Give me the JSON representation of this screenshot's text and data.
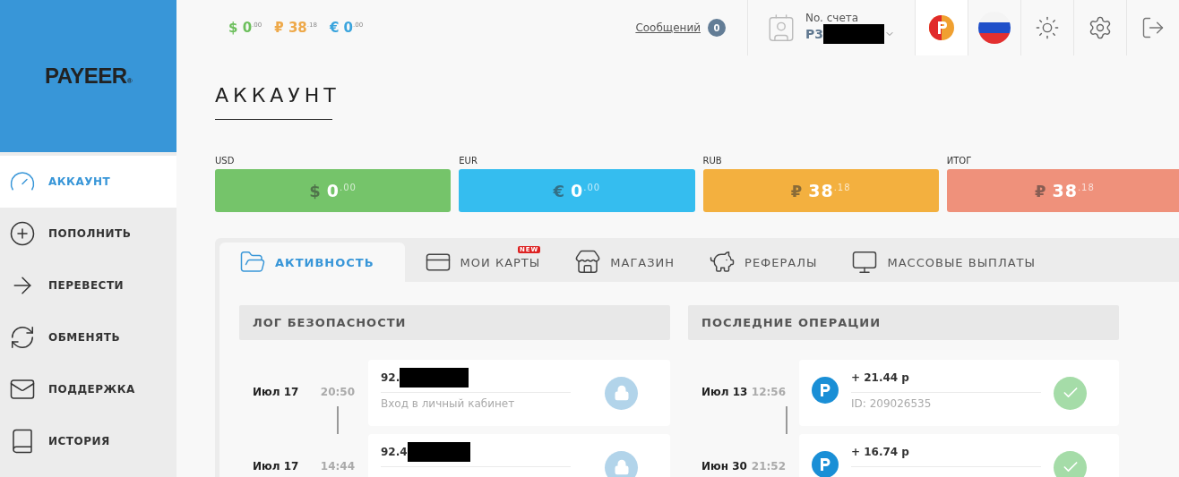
{
  "logo": {
    "text": "PAYEER",
    "mark": "®"
  },
  "sidebar": {
    "items": [
      {
        "label": "АККАУНТ",
        "kind": "gauge",
        "selected": true
      },
      {
        "label": "ПОПОЛНИТЬ",
        "kind": "plus",
        "selected": false
      },
      {
        "label": "ПЕРЕВЕСТИ",
        "kind": "arrow",
        "selected": false
      },
      {
        "label": "ОБМЕНЯТЬ",
        "kind": "exchange",
        "selected": false
      },
      {
        "label": "ПОДДЕРЖКА",
        "kind": "mail",
        "selected": false
      },
      {
        "label": "ИСТОРИЯ",
        "kind": "book",
        "selected": false
      }
    ]
  },
  "top_balances": [
    {
      "symbol": "$",
      "whole": "0",
      "fraction": ".00",
      "color": "#6cbf5c"
    },
    {
      "symbol": "₽",
      "whole": "38",
      "fraction": ".18",
      "color": "#eea94a"
    },
    {
      "symbol": "€",
      "whole": "0",
      "fraction": ".00",
      "color": "#3aa4dd"
    }
  ],
  "messages": {
    "label": "Сообщений",
    "count": "0"
  },
  "account": {
    "label": "No. счета",
    "number": "P3"
  },
  "page_title": "АККАУНТ",
  "balance_cards": [
    {
      "label": "USD",
      "symbol": "$",
      "whole": "0",
      "fraction": ".00",
      "color": "#75c46a"
    },
    {
      "label": "EUR",
      "symbol": "€",
      "whole": "0",
      "fraction": ".00",
      "color": "#35bdef"
    },
    {
      "label": "RUB",
      "symbol": "₽",
      "whole": "38",
      "fraction": ".18",
      "color": "#f3b03f"
    },
    {
      "label": "ИТОГ",
      "symbol": "₽",
      "whole": "38",
      "fraction": ".18",
      "color": "#ef917b"
    }
  ],
  "tabs": [
    {
      "label": "АКТИВНОСТЬ",
      "kind": "wallet",
      "selected": true
    },
    {
      "label": "МОИ КАРТЫ",
      "kind": "card",
      "selected": false,
      "badge": "NEW"
    },
    {
      "label": "МАГАЗИН",
      "kind": "store",
      "selected": false
    },
    {
      "label": "РЕФЕРАЛЫ",
      "kind": "piggy",
      "selected": false
    },
    {
      "label": "МАССОВЫЕ ВЫПЛАТЫ",
      "kind": "monitor",
      "selected": false
    }
  ],
  "security_log": {
    "title": "ЛОГ БЕЗОПАСНОСТИ",
    "rows": [
      {
        "date": "Июл 17",
        "time": "20:50",
        "ip": "92.",
        "event": "Вход в личный кабинет"
      },
      {
        "date": "Июл 17",
        "time": "14:44",
        "ip": "92.4"
      }
    ]
  },
  "operations": {
    "title": "ПОСЛЕДНИЕ ОПЕРАЦИИ",
    "rows": [
      {
        "date": "Июл 13",
        "time": "12:56",
        "amount": "+ 21.44 р",
        "id": "ID: 209026535"
      },
      {
        "date": "Июн 30",
        "time": "21:52",
        "amount": "+ 16.74 р"
      }
    ]
  }
}
